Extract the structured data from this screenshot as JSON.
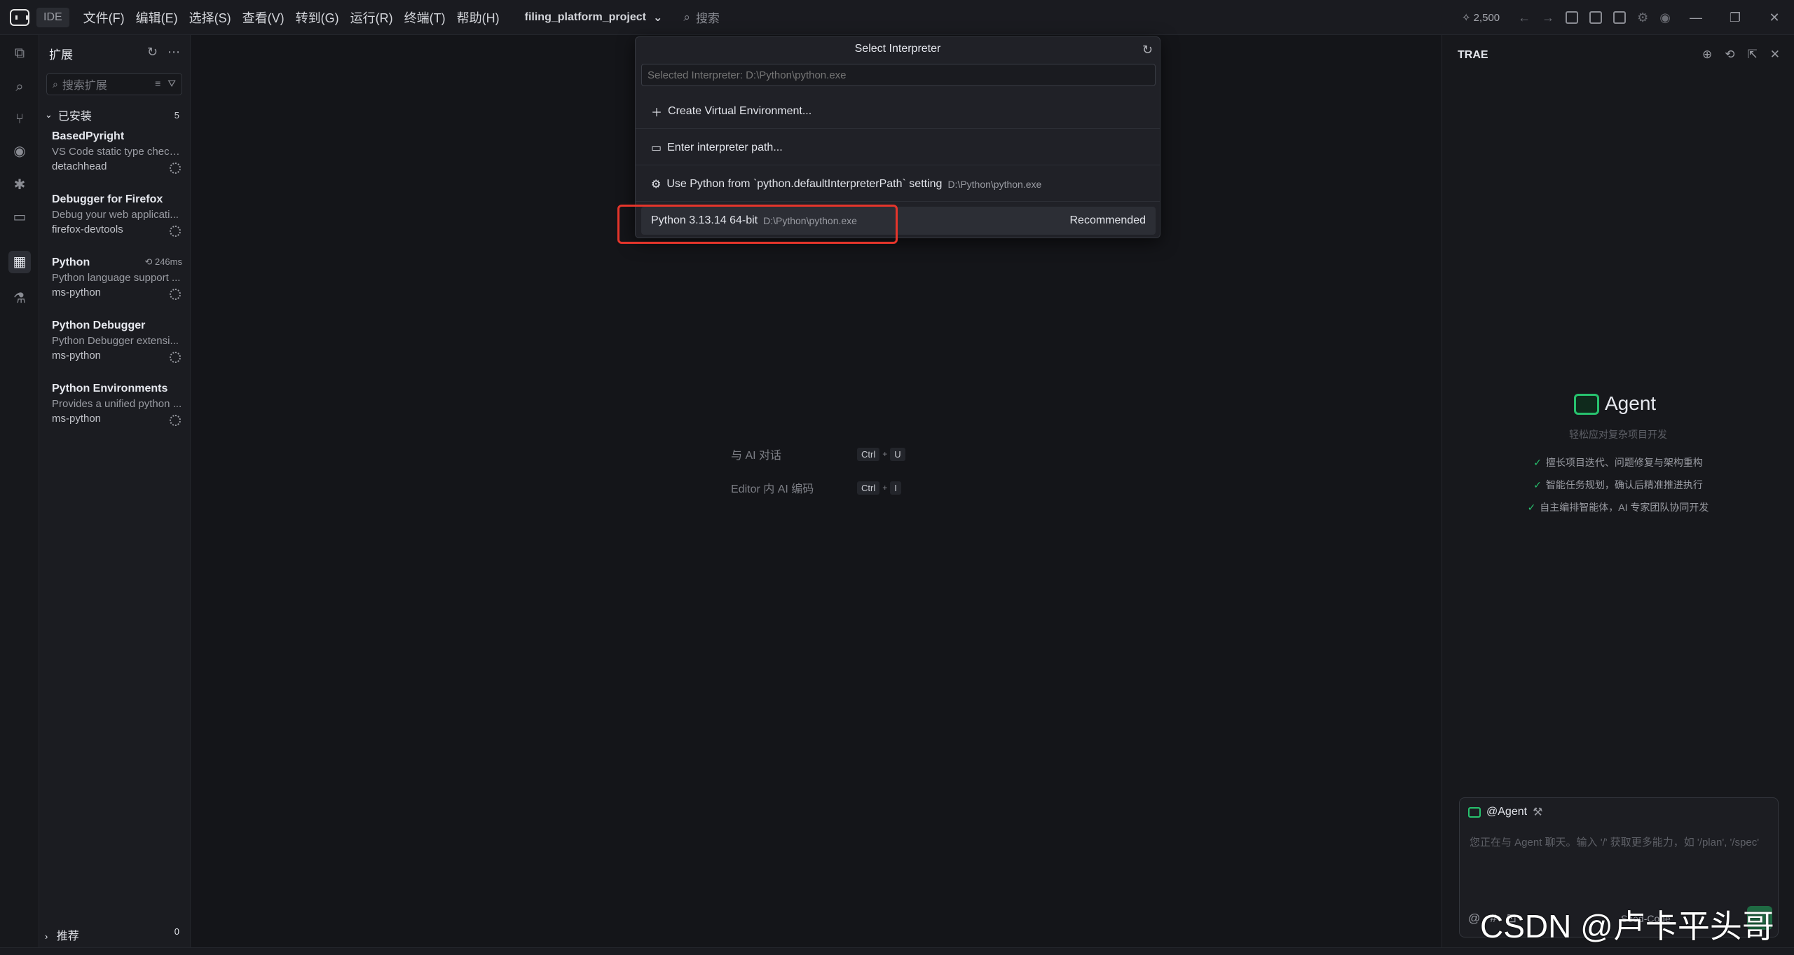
{
  "titlebar": {
    "ide_label": "IDE",
    "menu": [
      "文件(F)",
      "编辑(E)",
      "选择(S)",
      "查看(V)",
      "转到(G)",
      "运行(R)",
      "终端(T)",
      "帮助(H)"
    ],
    "project": "filing_platform_project",
    "search_placeholder": "搜索",
    "credits": "2,500",
    "window_controls": [
      "—",
      "❐",
      "✕"
    ]
  },
  "activity_bar": {
    "items": [
      "files-icon",
      "search-icon",
      "source-control-icon",
      "eye-icon",
      "debug-icon",
      "remote-icon",
      "extensions-icon",
      "testing-icon"
    ],
    "active": "extensions-icon"
  },
  "sidebar": {
    "title": "扩展",
    "search_placeholder": "搜索扩展",
    "installed_label": "已安装",
    "installed_count": "5",
    "extensions": [
      {
        "name": "BasedPyright",
        "desc": "VS Code static type checki...",
        "publisher": "detachhead"
      },
      {
        "name": "Debugger for Firefox",
        "desc": "Debug your web applicati...",
        "publisher": "firefox-devtools"
      },
      {
        "name": "Python",
        "desc": "Python language support ...",
        "publisher": "ms-python",
        "timing": "246ms"
      },
      {
        "name": "Python Debugger",
        "desc": "Python Debugger extensi...",
        "publisher": "ms-python"
      },
      {
        "name": "Python Environments",
        "desc": "Provides a unified python ...",
        "publisher": "ms-python"
      }
    ],
    "recommended_label": "推荐",
    "recommended_count": "0"
  },
  "quickpick": {
    "title": "Select Interpreter",
    "input_placeholder": "Selected Interpreter: D:\\Python\\python.exe",
    "items": [
      {
        "label": "Create Virtual Environment...",
        "detail": "",
        "tag": ""
      },
      {
        "label": "Enter interpreter path...",
        "detail": "",
        "tag": ""
      },
      {
        "label": "Use Python from `python.defaultInterpreterPath` setting",
        "detail": "D:\\Python\\python.exe",
        "tag": ""
      },
      {
        "label": "Python 3.13.14 64-bit",
        "detail": "D:\\Python\\python.exe",
        "tag": "Recommended"
      }
    ],
    "highlight_color": "#e5352b"
  },
  "editor": {
    "shortcuts": [
      {
        "label": "与 AI 对话",
        "keys": [
          "Ctrl",
          "U"
        ]
      },
      {
        "label": "Editor 内 AI 编码",
        "keys": [
          "Ctrl",
          "I"
        ]
      }
    ]
  },
  "right_panel": {
    "title": "TRAE",
    "agent_title": "Agent",
    "agent_subtitle": "轻松应对复杂项目开发",
    "features": [
      "擅长项目迭代、问题修复与架构重构",
      "智能任务规划，确认后精准推进执行",
      "自主编排智能体，AI 专家团队协同开发"
    ],
    "chat_agent": "@Agent",
    "chat_placeholder": "您正在与 Agent 聊天。输入 '/' 获取更多能力，如 '/plan', '/spec'",
    "chat_tools": [
      "@",
      "#",
      "⊡"
    ],
    "model": "Seed-Code",
    "accent": "#27c26e"
  },
  "watermark": "CSDN @卢卡平头哥"
}
